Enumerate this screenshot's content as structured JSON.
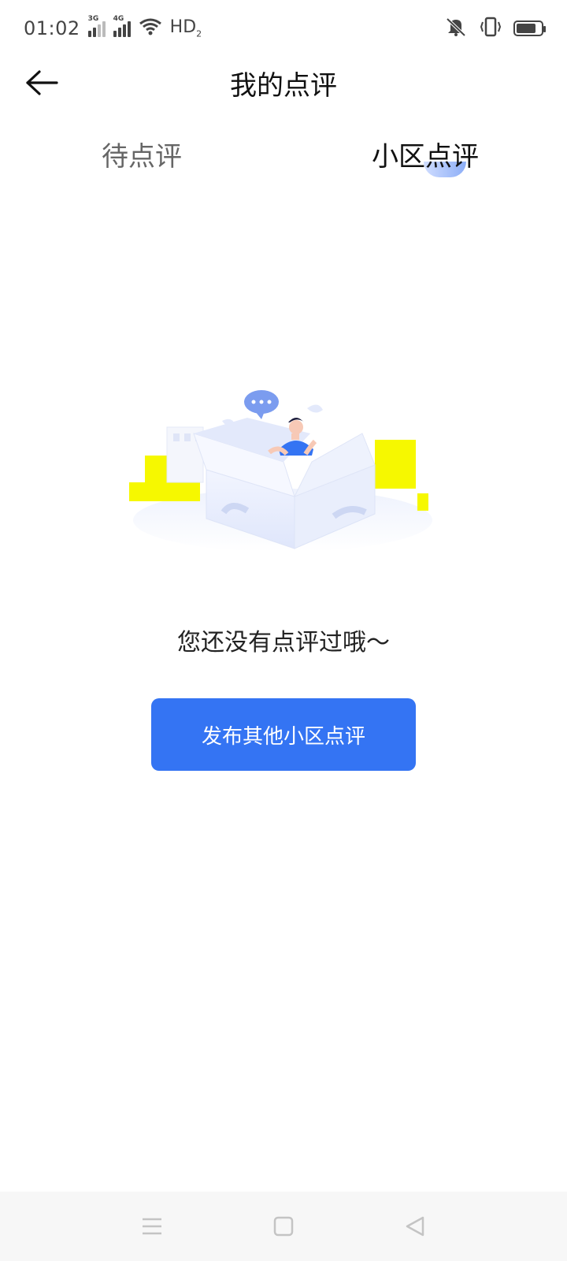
{
  "status_bar": {
    "time": "01:02",
    "network_1": "3G",
    "network_2": "4G",
    "hd_label": "HD",
    "hd_sub": "2",
    "icons": [
      "signal-3g-icon",
      "signal-4g-icon",
      "wifi-icon",
      "mute-icon",
      "vibrate-icon",
      "battery-icon"
    ]
  },
  "header": {
    "title": "我的点评",
    "back_icon": "arrow-left-icon"
  },
  "tabs": [
    {
      "label": "待点评",
      "active": false
    },
    {
      "label": "小区点评",
      "active": true
    }
  ],
  "empty_state": {
    "illustration": "open-box-with-person-illustration",
    "message": "您还没有点评过哦～",
    "button_label": "发布其他小区点评"
  },
  "nav_bar": {
    "icons": [
      "menu-icon",
      "home-square-icon",
      "back-triangle-icon"
    ]
  },
  "colors": {
    "primary": "#3474f3",
    "title_text": "#111111",
    "inactive_tab": "#666666",
    "nav_bg": "#f7f7f7",
    "highlight_yellow": "#f6f800"
  }
}
